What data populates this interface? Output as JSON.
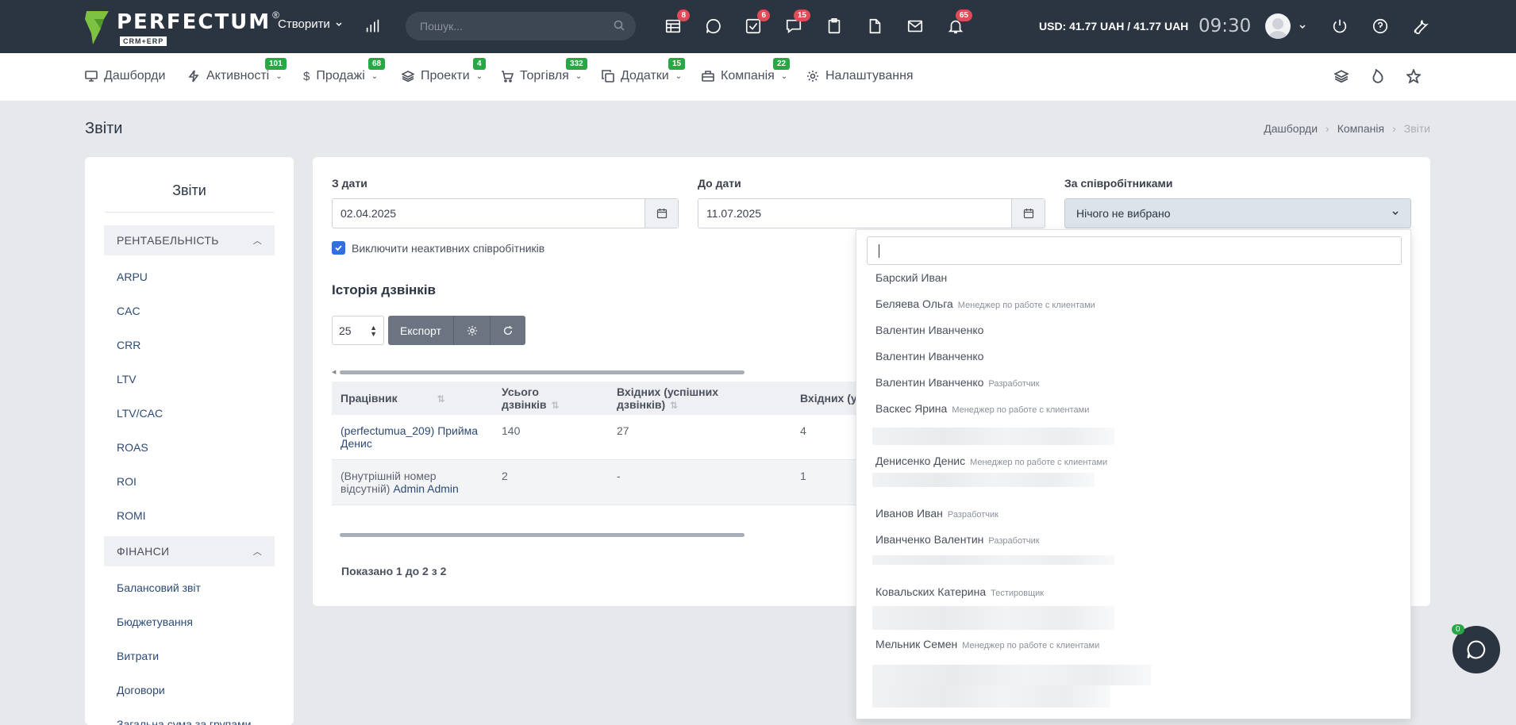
{
  "topbar": {
    "logo": "PERFECTUM",
    "logo_sub": "CRM+ERP",
    "logo_reg": "®",
    "create_label": "Створити",
    "search_placeholder": "Пошук...",
    "badges": {
      "tasks": "8",
      "checks": "6",
      "messages": "15",
      "bell": "65"
    },
    "currency": "USD: 41.77 UAH / 41.77 UAH",
    "time": "09:30"
  },
  "nav": {
    "items": [
      {
        "label": "Дашборди",
        "badge": ""
      },
      {
        "label": "Активності",
        "badge": "101"
      },
      {
        "label": "Продажі",
        "badge": "68"
      },
      {
        "label": "Проекти",
        "badge": "4"
      },
      {
        "label": "Торгівля",
        "badge": "332"
      },
      {
        "label": "Додатки",
        "badge": "15"
      },
      {
        "label": "Компанія",
        "badge": "22"
      },
      {
        "label": "Налаштування",
        "badge": ""
      }
    ]
  },
  "page": {
    "title": "Звіти",
    "breadcrumb": [
      "Дашборди",
      "Компанія",
      "Звіти"
    ]
  },
  "sidebar": {
    "title": "Звіти",
    "section1": "РЕНТАБЕЛЬНІСТЬ",
    "section1_items": [
      "ARPU",
      "CAC",
      "CRR",
      "LTV",
      "LTV/CAC",
      "ROAS",
      "ROI",
      "ROMI"
    ],
    "section2": "ФІНАНСИ",
    "section2_items": [
      "Балансовий звіт",
      "Бюджетування",
      "Витрати",
      "Договори",
      "Загальна сума за групами"
    ]
  },
  "filters": {
    "from_label": "З дати",
    "from_value": "02.04.2025",
    "to_label": "До дати",
    "to_value": "11.07.2025",
    "employees_label": "За співробітниками",
    "employees_value": "Нічого не вибрано",
    "exclude_inactive": "Виключити неактивних співробітників"
  },
  "history": {
    "title": "Історія дзвінків",
    "per_page": "25",
    "export": "Експорт",
    "columns": [
      "Працівник",
      "Усього дзвінків",
      "Вхідних (успішних дзвінків)",
      "Вхідних (у"
    ],
    "rows": [
      {
        "prefix": "(perfectumua_209)",
        "name": "Прийма Денис",
        "total": "140",
        "incoming": "27",
        "other": "4"
      },
      {
        "prefix": "(Внутрішній номер відсутній)",
        "name": "Admin Admin",
        "total": "2",
        "incoming": "-",
        "other": "1"
      }
    ],
    "shown": "Показано 1 до 2 з 2"
  },
  "dropdown": {
    "items": [
      {
        "name": "Барский Иван",
        "role": ""
      },
      {
        "name": "Беляева Ольга",
        "role": "Менеджер по работе с клиентами"
      },
      {
        "name": "Валентин Иванченко",
        "role": ""
      },
      {
        "name": "Валентин Иванченко",
        "role": ""
      },
      {
        "name": "Валентин Иванченко",
        "role": "Разработчик"
      },
      {
        "name": "Васкес Ярина",
        "role": "Менеджер по работе с клиентами"
      },
      {
        "name": "Денисенко Денис",
        "role": "Менеджер по работе с клиентами"
      },
      {
        "name": "Иванов Иван",
        "role": "Разработчик"
      },
      {
        "name": "Иванченко Валентин",
        "role": "Разработчик"
      },
      {
        "name": "Ковальских Катерина",
        "role": "Тестировщик"
      },
      {
        "name": "Мельник Семен",
        "role": "Менеджер по работе с клиентами"
      }
    ]
  },
  "chat": {
    "badge": "0"
  },
  "colors": {
    "topbar": "#2b3441",
    "accent_green": "#28a745",
    "badge_red": "#e14b57",
    "link": "#2c4a75"
  }
}
